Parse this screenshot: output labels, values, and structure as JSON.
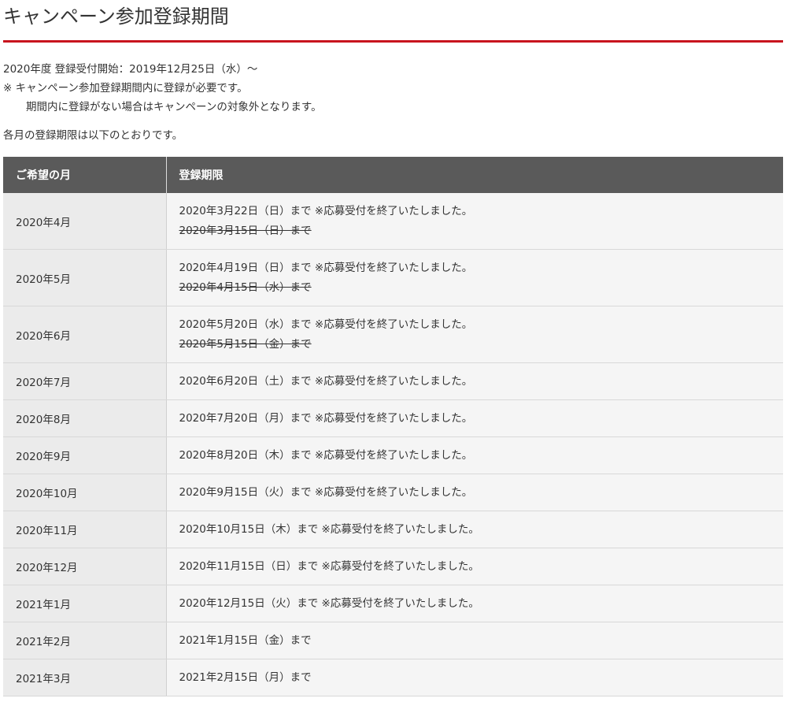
{
  "page": {
    "title": "キャンペーン参加登録期間"
  },
  "intro": {
    "line1": "2020年度 登録受付開始：2019年12月25日（水）～",
    "line2": "※ キャンペーン参加登録期間内に登録が必要です。",
    "line3": "期間内に登録がない場合はキャンペーンの対象外となります。",
    "line4": "各月の登録期限は以下のとおりです。"
  },
  "table": {
    "headers": {
      "month": "ご希望の月",
      "deadline": "登録期限"
    },
    "rows": [
      {
        "month": "2020年4月",
        "deadline": "2020年3月22日（日）まで ※応募受付を終了いたしました。",
        "old": "2020年3月15日（日）まで"
      },
      {
        "month": "2020年5月",
        "deadline": "2020年4月19日（日）まで ※応募受付を終了いたしました。",
        "old": "2020年4月15日（水）まで"
      },
      {
        "month": "2020年6月",
        "deadline": "2020年5月20日（水）まで ※応募受付を終了いたしました。",
        "old": "2020年5月15日（金）まで"
      },
      {
        "month": "2020年7月",
        "deadline": "2020年6月20日（土）まで ※応募受付を終了いたしました。"
      },
      {
        "month": "2020年8月",
        "deadline": "2020年7月20日（月）まで ※応募受付を終了いたしました。"
      },
      {
        "month": "2020年9月",
        "deadline": "2020年8月20日（木）まで ※応募受付を終了いたしました。"
      },
      {
        "month": "2020年10月",
        "deadline": "2020年9月15日（火）まで ※応募受付を終了いたしました。"
      },
      {
        "month": "2020年11月",
        "deadline": "2020年10月15日（木）まで ※応募受付を終了いたしました。"
      },
      {
        "month": "2020年12月",
        "deadline": "2020年11月15日（日）まで ※応募受付を終了いたしました。"
      },
      {
        "month": "2021年1月",
        "deadline": "2020年12月15日（火）まで ※応募受付を終了いたしました。"
      },
      {
        "month": "2021年2月",
        "deadline": "2021年1月15日（金）まで"
      },
      {
        "month": "2021年3月",
        "deadline": "2021年2月15日（月）まで"
      }
    ]
  },
  "colors": {
    "accent_rule": "#c8141e",
    "header_bg": "#5a5a5a",
    "month_cell_bg": "#ebebeb",
    "deadline_cell_bg": "#f5f5f5"
  }
}
